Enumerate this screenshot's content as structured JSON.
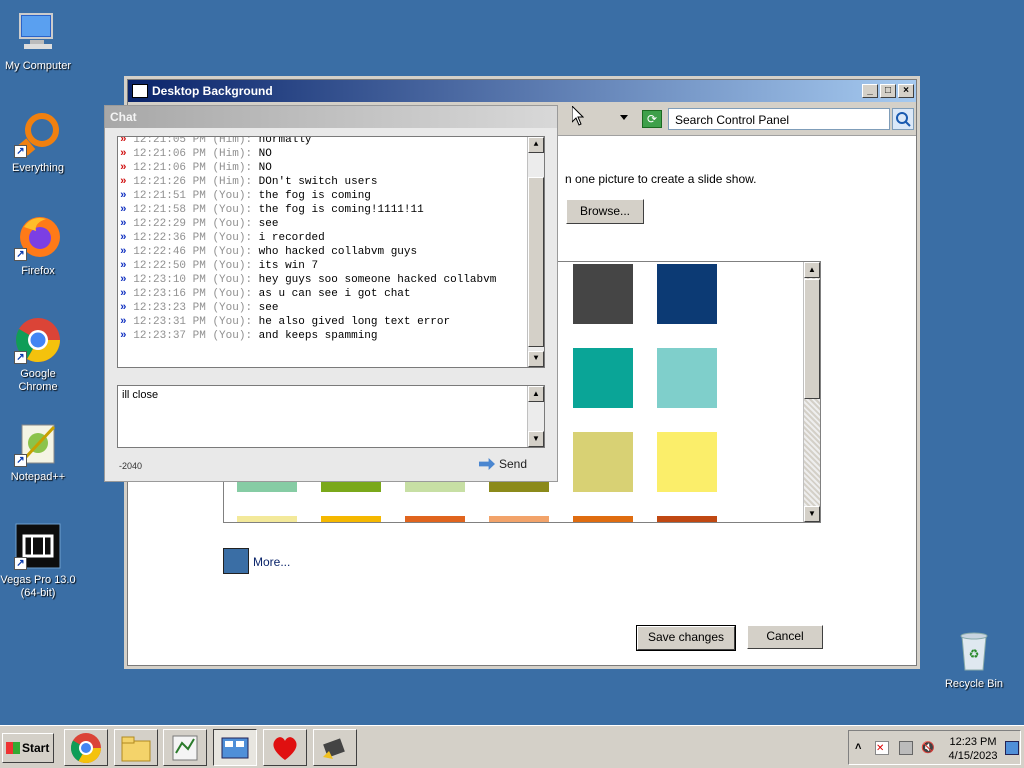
{
  "desktop": {
    "icons": [
      {
        "label": "My Computer"
      },
      {
        "label": "Everything"
      },
      {
        "label": "Firefox"
      },
      {
        "label": "Google Chrome"
      },
      {
        "label": "Notepad++"
      },
      {
        "label": "Vegas Pro 13.0\n(64-bit)"
      },
      {
        "label": "Recycle Bin"
      }
    ]
  },
  "window": {
    "title": "Desktop Background",
    "search_placeholder": "Search Control Panel",
    "hint_text": "n one picture to create a slide show.",
    "browse_label": "Browse...",
    "more_label": "More...",
    "save_label": "Save changes",
    "cancel_label": "Cancel",
    "swatches": [
      {
        "color": "#454545"
      },
      {
        "color": "#0c3a74"
      },
      {
        "color": "#0aa597"
      },
      {
        "color": "#7fcfcb"
      },
      {
        "color": "#d8d174"
      },
      {
        "color": "#fbee6a"
      },
      {
        "color": "#86cca4"
      },
      {
        "color": "#7aa81a"
      },
      {
        "color": "#c7dfa4"
      },
      {
        "color": "#8b8a1a"
      },
      {
        "color": "#f3e99a"
      },
      {
        "color": "#f5b800"
      },
      {
        "color": "#e0641e"
      },
      {
        "color": "#f2a36a"
      },
      {
        "color": "#df6c10"
      },
      {
        "color": "#c04812"
      }
    ]
  },
  "chat": {
    "title": "Chat",
    "messages": [
      {
        "who": "him",
        "time": "12:21:05 PM",
        "sender": "(Him):",
        "text": "normally"
      },
      {
        "who": "him",
        "time": "12:21:06 PM",
        "sender": "(Him):",
        "text": "NO"
      },
      {
        "who": "him",
        "time": "12:21:06 PM",
        "sender": "(Him):",
        "text": "NO"
      },
      {
        "who": "him",
        "time": "12:21:26 PM",
        "sender": "(Him):",
        "text": "DOn't switch users"
      },
      {
        "who": "you",
        "time": "12:21:51 PM",
        "sender": "(You):",
        "text": "the fog is coming"
      },
      {
        "who": "you",
        "time": "12:21:58 PM",
        "sender": "(You):",
        "text": "the fog is coming!1111!11"
      },
      {
        "who": "you",
        "time": "12:22:29 PM",
        "sender": "(You):",
        "text": "see"
      },
      {
        "who": "you",
        "time": "12:22:36 PM",
        "sender": "(You):",
        "text": "i recorded"
      },
      {
        "who": "you",
        "time": "12:22:46 PM",
        "sender": "(You):",
        "text": "who hacked collabvm guys"
      },
      {
        "who": "you",
        "time": "12:22:50 PM",
        "sender": "(You):",
        "text": "its win 7"
      },
      {
        "who": "you",
        "time": "12:23:10 PM",
        "sender": "(You):",
        "text": "hey guys soo someone hacked collabvm"
      },
      {
        "who": "you",
        "time": "12:23:16 PM",
        "sender": "(You):",
        "text": "as u can see i got chat"
      },
      {
        "who": "you",
        "time": "12:23:23 PM",
        "sender": "(You):",
        "text": "see"
      },
      {
        "who": "you",
        "time": "12:23:31 PM",
        "sender": "(You):",
        "text": "he also gived long text error"
      },
      {
        "who": "you",
        "time": "12:23:37 PM",
        "sender": "(You):",
        "text": "and keeps spamming"
      }
    ],
    "marker": "»",
    "input_value": "ill close",
    "char_count": "-2040",
    "send_label": "Send"
  },
  "taskbar": {
    "start_label": "Start",
    "clock_time": "12:23 PM",
    "clock_date": "4/15/2023"
  }
}
